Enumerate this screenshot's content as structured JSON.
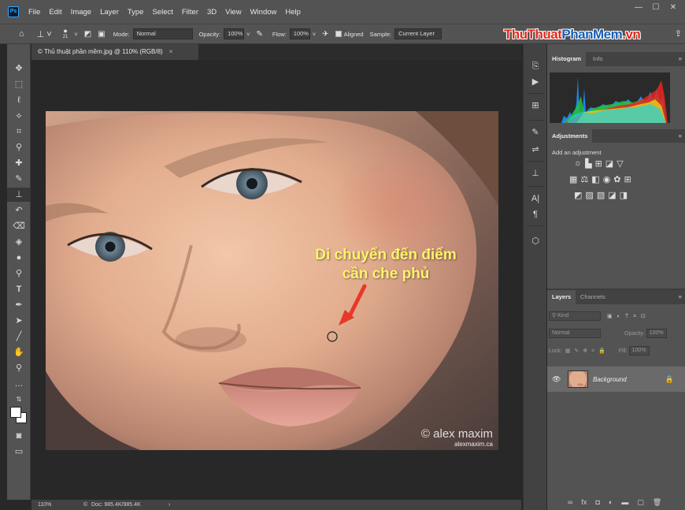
{
  "app": {
    "logo": "Ps"
  },
  "menu": [
    "File",
    "Edit",
    "Image",
    "Layer",
    "Type",
    "Select",
    "Filter",
    "3D",
    "View",
    "Window",
    "Help"
  ],
  "window_controls": {
    "minimize": "—",
    "maximize": "☐",
    "close": "✕"
  },
  "options": {
    "brush_size": "21",
    "mode_label": "Mode:",
    "mode_value": "Normal",
    "opacity_label": "Opacity:",
    "opacity_value": "100%",
    "flow_label": "Flow:",
    "flow_value": "100%",
    "aligned_label": "Aligned",
    "sample_label": "Sample:",
    "sample_value": "Current Layer"
  },
  "watermark": {
    "part1": "ThuThuat",
    "part2": "PhanMem",
    "part3": ".vn"
  },
  "document": {
    "tab_title": "© Thủ thuật phần mềm.jpg @ 110% (RGB/8)",
    "tab_close": "×",
    "zoom": "110%",
    "doc_info": "Doc: 985.4K/985.4K",
    "status_arrow": "›"
  },
  "annotation": {
    "line1": "Di chuyển đến điểm",
    "line2": "cần che phủ"
  },
  "photo_credit": {
    "line1": "© alex maxim",
    "line2": "alexmaxim.ca"
  },
  "panels": {
    "histogram_tab": "Histogram",
    "info_tab": "Info",
    "adjustments_tab": "Adjustments",
    "adjustments_hint": "Add an adjustment",
    "layers_tab": "Layers",
    "channels_tab": "Channels",
    "kind_placeholder": "Kind",
    "blend_mode": "Normal",
    "opacity_label": "Opacity:",
    "opacity_value": "100%",
    "lock_label": "Lock:",
    "fill_label": "Fill:",
    "fill_value": "100%",
    "layer_name": "Background"
  },
  "colors": {
    "panel_bg": "#535353",
    "dark_bg": "#282828",
    "annotation_text": "#fff36a",
    "arrow": "#e8382a"
  }
}
